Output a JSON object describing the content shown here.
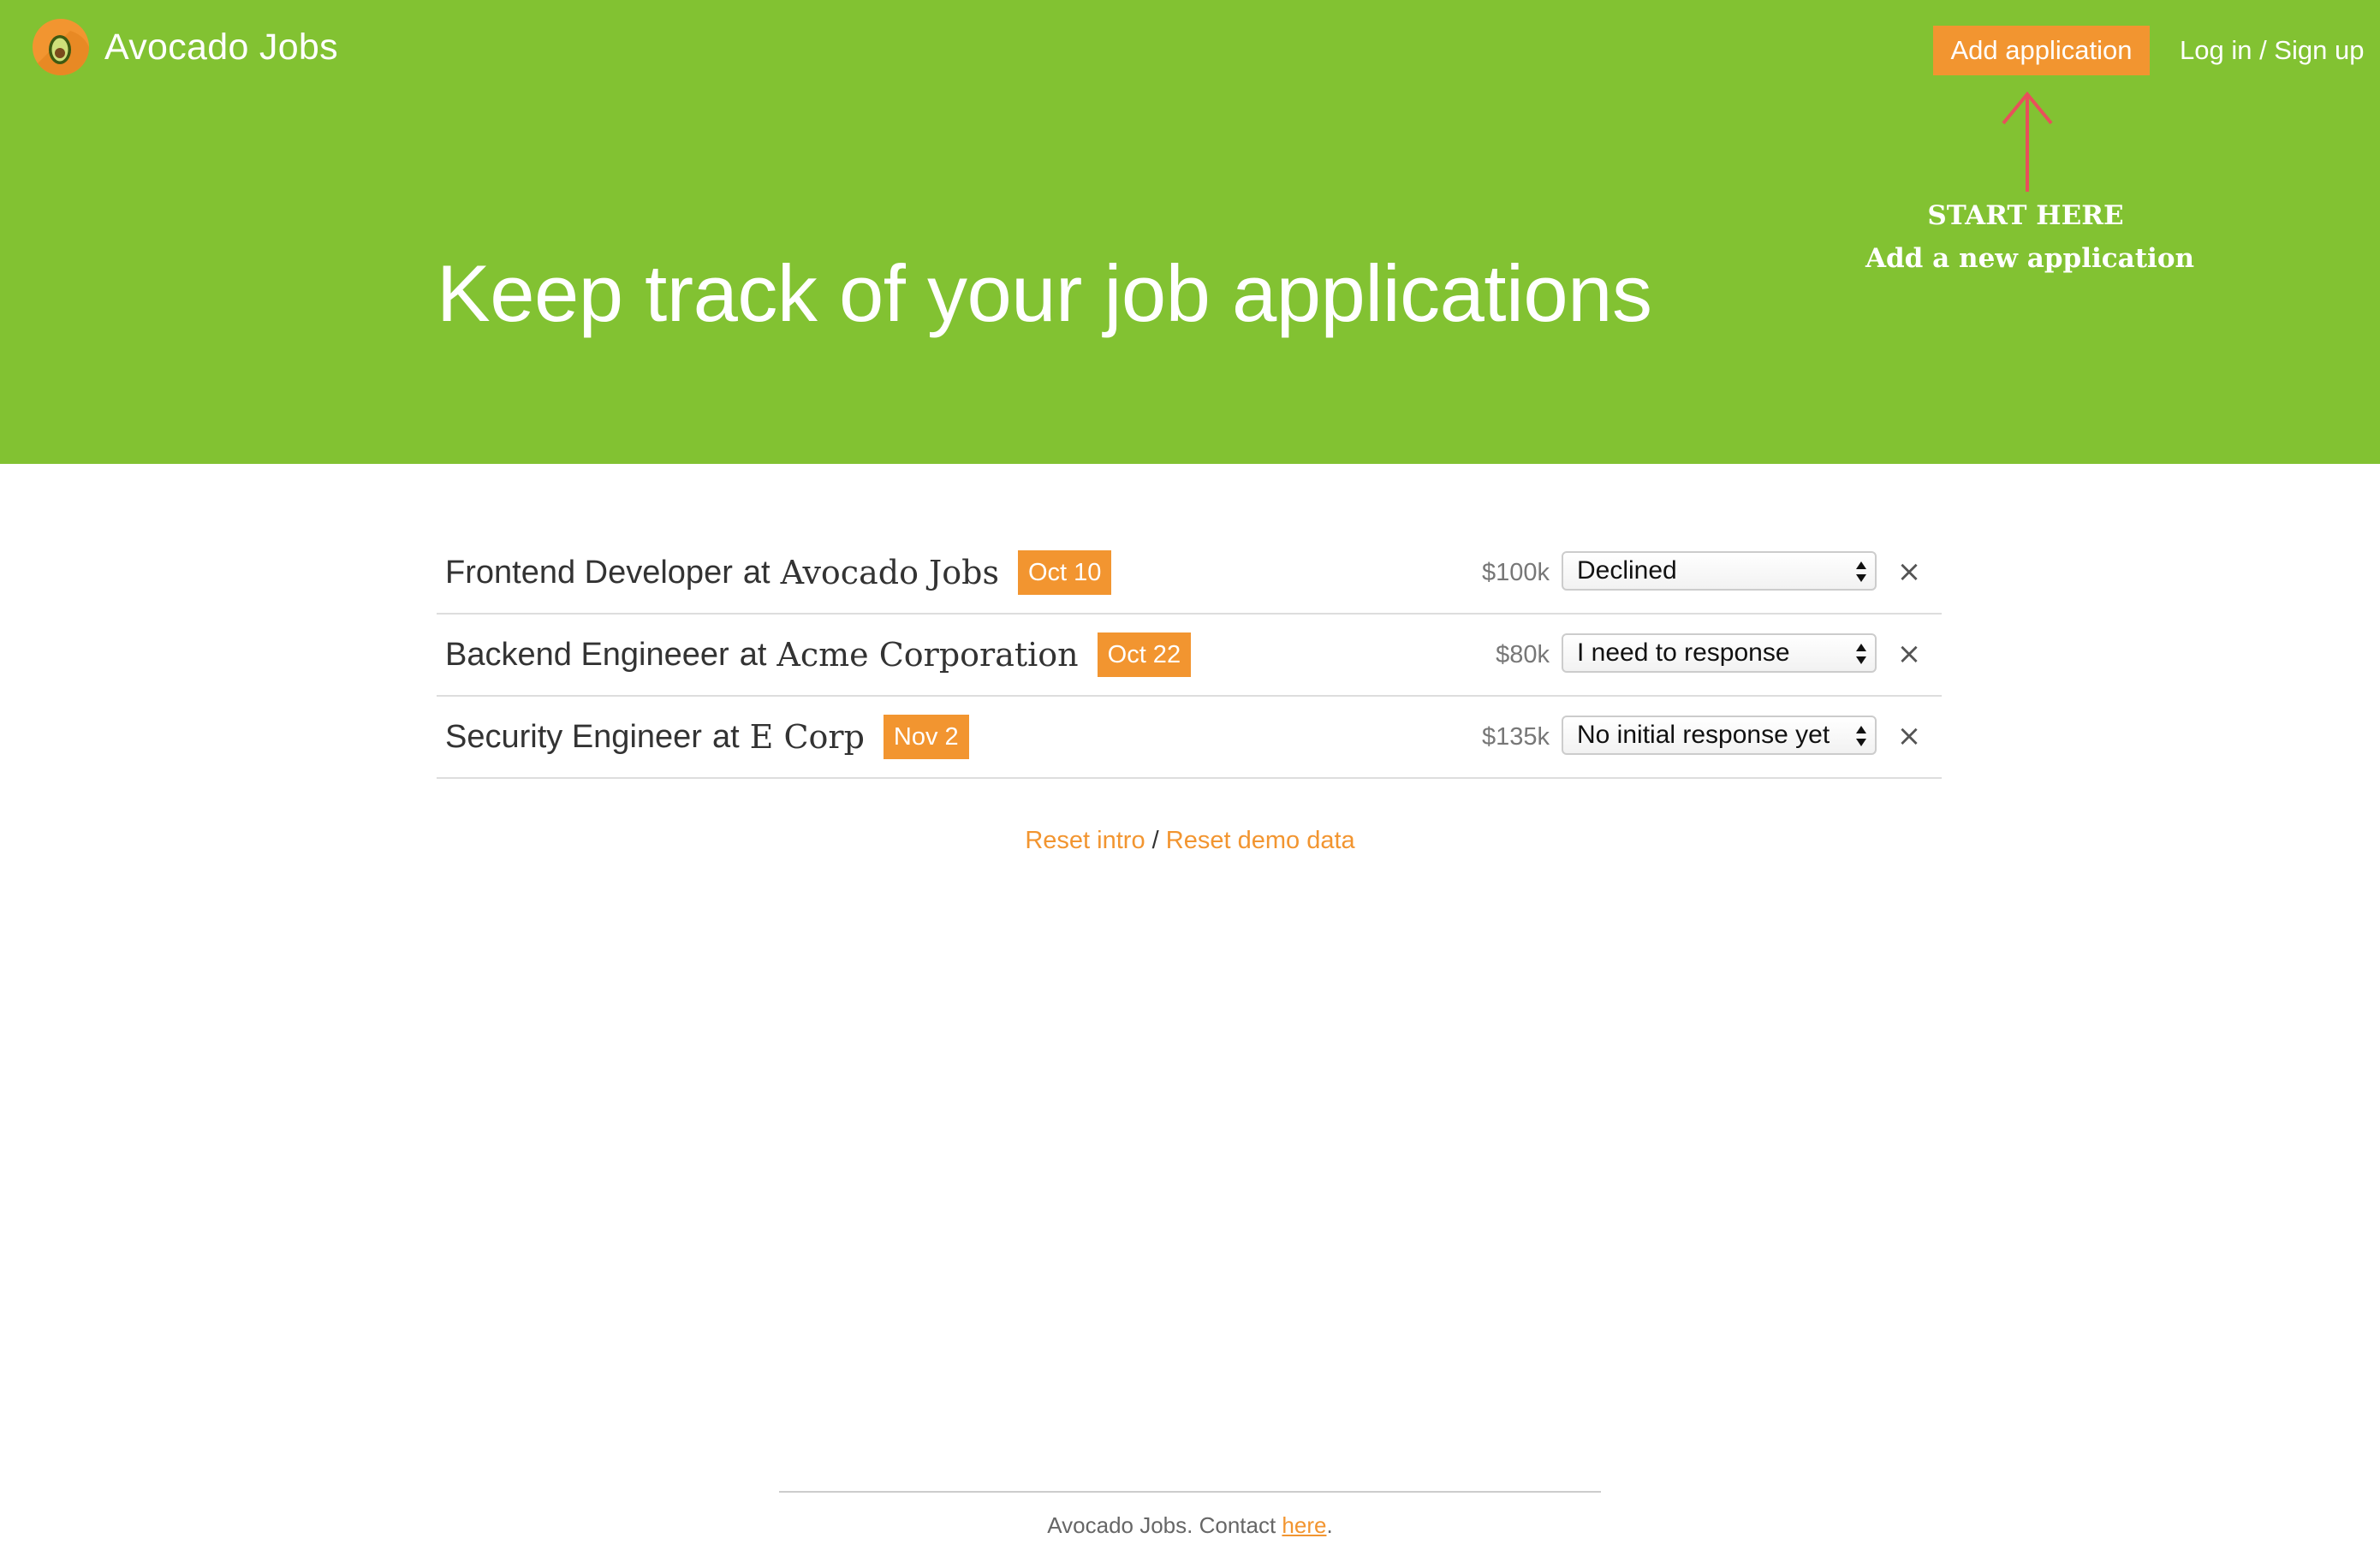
{
  "brand": {
    "name": "Avocado Jobs",
    "logo_icon": "avocado-logo-icon"
  },
  "nav": {
    "add_label": "Add application",
    "login_label": "Log in / Sign up"
  },
  "intro_hint": {
    "arrow_icon": "arrow-up-icon",
    "title": "START HERE",
    "subtitle": "Add a new application"
  },
  "hero": {
    "headline": "Keep track of your job applications"
  },
  "applications": [
    {
      "title": "Frontend Developer",
      "at": "at",
      "company": "Avocado Jobs",
      "date": "Oct 10",
      "salary": "$100k",
      "status": "Declined",
      "remove": "×"
    },
    {
      "title": "Backend Engineeer",
      "at": "at",
      "company": "Acme Corporation",
      "date": "Oct 22",
      "salary": "$80k",
      "status": "I need to response",
      "remove": "×"
    },
    {
      "title": "Security Engineer",
      "at": "at",
      "company": "E Corp",
      "date": "Nov 2",
      "salary": "$135k",
      "status": "No initial response yet",
      "remove": "×"
    }
  ],
  "reset": {
    "intro_label": "Reset intro",
    "separator": "/",
    "demo_label": "Reset demo data"
  },
  "footer": {
    "text": "Avocado Jobs. Contact ",
    "link_label": "here",
    "period": "."
  },
  "colors": {
    "hero_green": "#82c232",
    "accent_orange": "#f29530",
    "annotation_red": "#e8505b"
  }
}
